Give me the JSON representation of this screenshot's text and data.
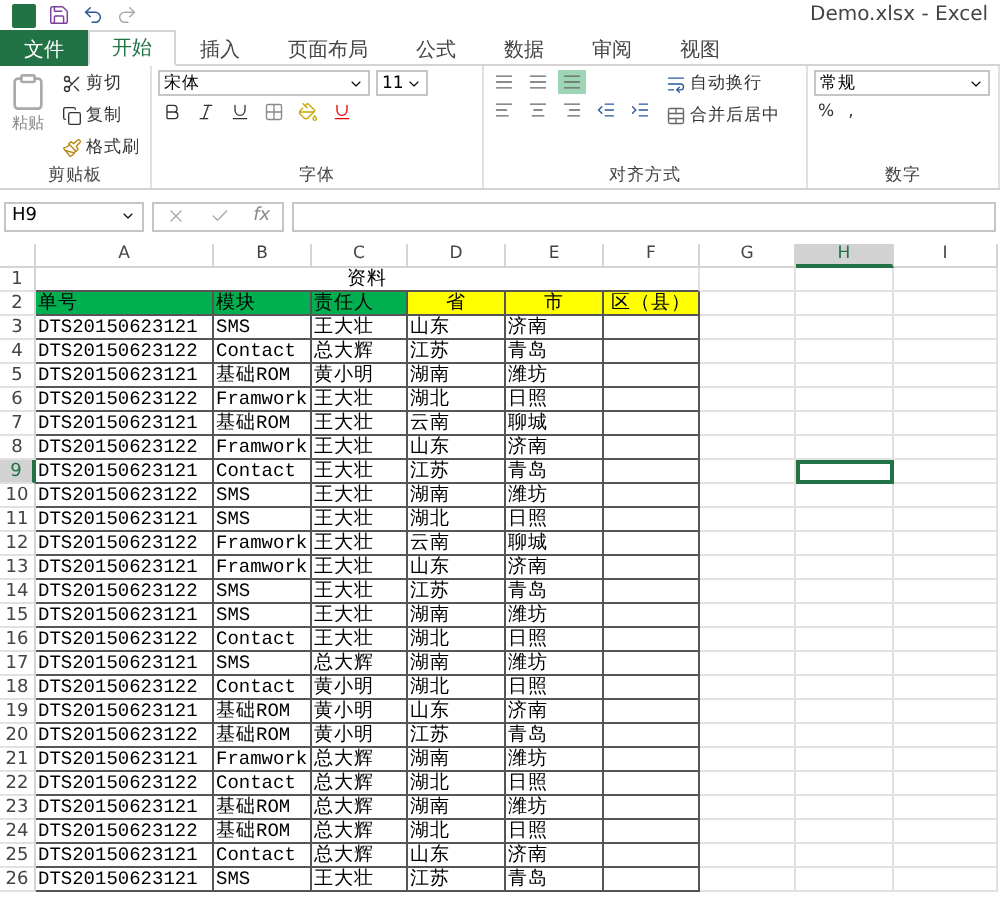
{
  "window": {
    "title": "Demo.xlsx - Excel"
  },
  "tabs": [
    {
      "label": "文件",
      "kind": "file",
      "selected": false
    },
    {
      "label": "开始",
      "kind": "tab",
      "selected": true
    },
    {
      "label": "插入",
      "kind": "tab",
      "selected": false
    },
    {
      "label": "页面布局",
      "kind": "tab",
      "selected": false
    },
    {
      "label": "公式",
      "kind": "tab",
      "selected": false
    },
    {
      "label": "数据",
      "kind": "tab",
      "selected": false
    },
    {
      "label": "审阅",
      "kind": "tab",
      "selected": false
    },
    {
      "label": "视图",
      "kind": "tab",
      "selected": false
    }
  ],
  "ribbon": {
    "clipboard": {
      "paste": "粘贴",
      "cut": "剪切",
      "copy": "复制",
      "format_painter": "格式刷",
      "label": "剪贴板"
    },
    "font": {
      "font_name": "宋体",
      "font_size": "11",
      "label": "字体"
    },
    "alignment": {
      "wrap_text": "自动换行",
      "merge_center": "合并后居中",
      "label": "对齐方式"
    },
    "number": {
      "format": "常规",
      "percent": "%",
      "comma": ",",
      "label": "数字"
    }
  },
  "formula_bar": {
    "name_box": "H9",
    "function_label": "fx"
  },
  "sheet": {
    "columns": [
      {
        "letter": "A",
        "selected": false
      },
      {
        "letter": "B",
        "selected": false
      },
      {
        "letter": "C",
        "selected": false
      },
      {
        "letter": "D",
        "selected": false
      },
      {
        "letter": "E",
        "selected": false
      },
      {
        "letter": "F",
        "selected": false
      },
      {
        "letter": "G",
        "selected": false
      },
      {
        "letter": "H",
        "selected": true
      },
      {
        "letter": "I",
        "selected": false
      }
    ],
    "title_row": {
      "number": "1",
      "text": "资料",
      "selected": false
    },
    "header_row": {
      "number": "2",
      "selected": false,
      "cells": [
        {
          "text": "单号",
          "color": "#00b050"
        },
        {
          "text": "模块",
          "color": "#00b050"
        },
        {
          "text": "责任人",
          "color": "#00b050"
        },
        {
          "text": "省",
          "color": "#ffff00"
        },
        {
          "text": "市",
          "color": "#ffff00"
        },
        {
          "text": "区（县）",
          "color": "#ffff00"
        }
      ]
    },
    "rows": [
      {
        "number": "3",
        "selected": false,
        "cells": [
          "DTS20150623121",
          "SMS",
          "王大壮",
          "山东",
          "济南"
        ]
      },
      {
        "number": "4",
        "selected": false,
        "cells": [
          "DTS20150623122",
          "Contact",
          "总大辉",
          "江苏",
          "青岛"
        ]
      },
      {
        "number": "5",
        "selected": false,
        "cells": [
          "DTS20150623121",
          "基础ROM",
          "黄小明",
          "湖南",
          "潍坊"
        ]
      },
      {
        "number": "6",
        "selected": false,
        "cells": [
          "DTS20150623122",
          "Framwork",
          "王大壮",
          "湖北",
          "日照"
        ]
      },
      {
        "number": "7",
        "selected": false,
        "cells": [
          "DTS20150623121",
          "基础ROM",
          "王大壮",
          "云南",
          "聊城"
        ]
      },
      {
        "number": "8",
        "selected": false,
        "cells": [
          "DTS20150623122",
          "Framwork",
          "王大壮",
          "山东",
          "济南"
        ]
      },
      {
        "number": "9",
        "selected": true,
        "cells": [
          "DTS20150623121",
          "Contact",
          "王大壮",
          "江苏",
          "青岛"
        ]
      },
      {
        "number": "10",
        "selected": false,
        "cells": [
          "DTS20150623122",
          "SMS",
          "王大壮",
          "湖南",
          "潍坊"
        ]
      },
      {
        "number": "11",
        "selected": false,
        "cells": [
          "DTS20150623121",
          "SMS",
          "王大壮",
          "湖北",
          "日照"
        ]
      },
      {
        "number": "12",
        "selected": false,
        "cells": [
          "DTS20150623122",
          "Framwork",
          "王大壮",
          "云南",
          "聊城"
        ]
      },
      {
        "number": "13",
        "selected": false,
        "cells": [
          "DTS20150623121",
          "Framwork",
          "王大壮",
          "山东",
          "济南"
        ]
      },
      {
        "number": "14",
        "selected": false,
        "cells": [
          "DTS20150623122",
          "SMS",
          "王大壮",
          "江苏",
          "青岛"
        ]
      },
      {
        "number": "15",
        "selected": false,
        "cells": [
          "DTS20150623121",
          "SMS",
          "王大壮",
          "湖南",
          "潍坊"
        ]
      },
      {
        "number": "16",
        "selected": false,
        "cells": [
          "DTS20150623122",
          "Contact",
          "王大壮",
          "湖北",
          "日照"
        ]
      },
      {
        "number": "17",
        "selected": false,
        "cells": [
          "DTS20150623121",
          "SMS",
          "总大辉",
          "湖南",
          "潍坊"
        ]
      },
      {
        "number": "18",
        "selected": false,
        "cells": [
          "DTS20150623122",
          "Contact",
          "黄小明",
          "湖北",
          "日照"
        ]
      },
      {
        "number": "19",
        "selected": false,
        "cells": [
          "DTS20150623121",
          "基础ROM",
          "黄小明",
          "山东",
          "济南"
        ]
      },
      {
        "number": "20",
        "selected": false,
        "cells": [
          "DTS20150623122",
          "基础ROM",
          "黄小明",
          "江苏",
          "青岛"
        ]
      },
      {
        "number": "21",
        "selected": false,
        "cells": [
          "DTS20150623121",
          "Framwork",
          "总大辉",
          "湖南",
          "潍坊"
        ]
      },
      {
        "number": "22",
        "selected": false,
        "cells": [
          "DTS20150623122",
          "Contact",
          "总大辉",
          "湖北",
          "日照"
        ]
      },
      {
        "number": "23",
        "selected": false,
        "cells": [
          "DTS20150623121",
          "基础ROM",
          "总大辉",
          "湖南",
          "潍坊"
        ]
      },
      {
        "number": "24",
        "selected": false,
        "cells": [
          "DTS20150623122",
          "基础ROM",
          "总大辉",
          "湖北",
          "日照"
        ]
      },
      {
        "number": "25",
        "selected": false,
        "cells": [
          "DTS20150623121",
          "Contact",
          "总大辉",
          "山东",
          "济南"
        ]
      },
      {
        "number": "26",
        "selected": false,
        "cells": [
          "DTS20150623121",
          "SMS",
          "王大壮",
          "江苏",
          "青岛"
        ]
      }
    ]
  }
}
